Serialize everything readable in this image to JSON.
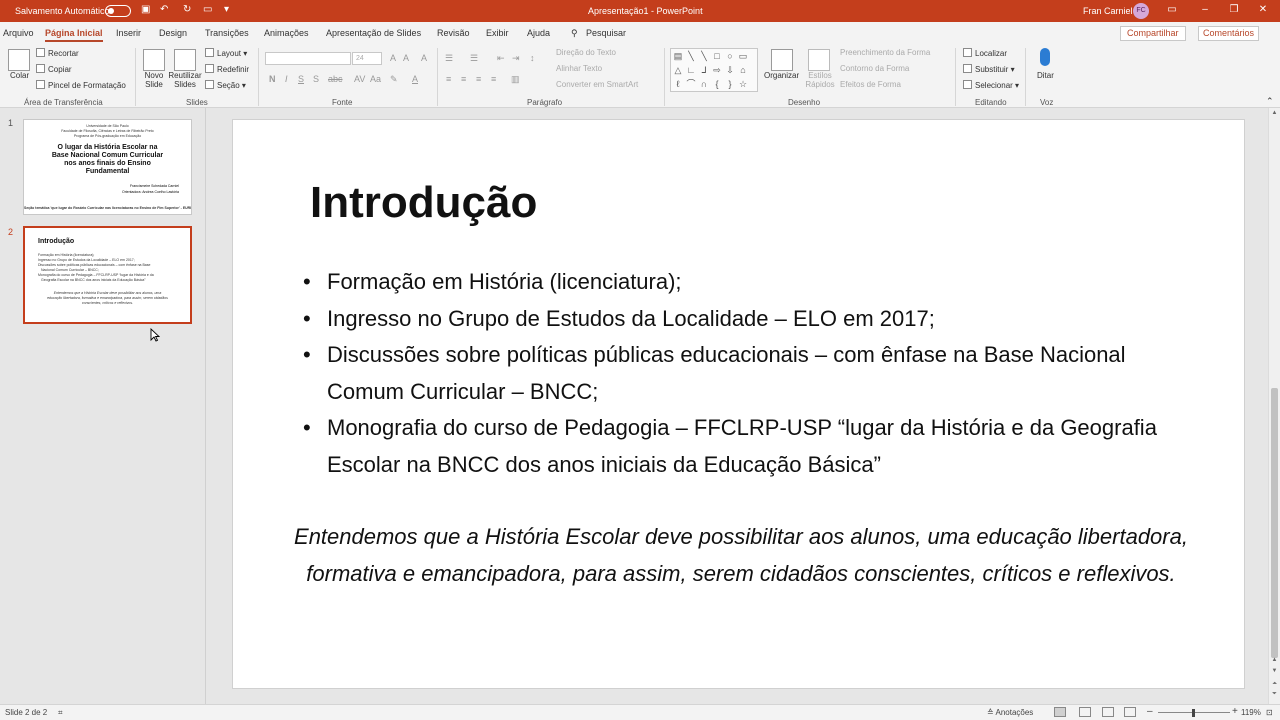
{
  "titlebar": {
    "autosave_label": "Salvamento Automático",
    "doc_title": "Apresentação1 - PowerPoint",
    "user_name": "Fran Carniel",
    "user_initials": "FC"
  },
  "tabs": {
    "items": [
      "Arquivo",
      "Página Inicial",
      "Inserir",
      "Design",
      "Transições",
      "Animações",
      "Apresentação de Slides",
      "Revisão",
      "Exibir",
      "Ajuda",
      "Pesquisar"
    ],
    "active": "Página Inicial",
    "share_label": "Compartilhar",
    "comments_label": "Comentários"
  },
  "ribbon": {
    "clipboard": {
      "paste": "Colar",
      "cut": "Recortar",
      "copy": "Copiar",
      "format_painter": "Pincel de Formatação",
      "group": "Área de Transferência"
    },
    "slides": {
      "new_slide": "Novo Slide",
      "reuse": "Reutilizar Slides",
      "layout": "Layout",
      "reset": "Redefinir",
      "section": "Seção",
      "group": "Slides"
    },
    "font": {
      "size": "24",
      "bold": "N",
      "italic": "I",
      "underline": "S",
      "strike": "S",
      "group": "Fonte"
    },
    "paragraph": {
      "text_direction": "Direção do Texto",
      "align_text": "Alinhar Texto",
      "smartart": "Converter em SmartArt",
      "group": "Parágrafo"
    },
    "drawing": {
      "arrange": "Organizar",
      "quick_styles": "Estilos Rápidos",
      "shape_fill": "Preenchimento da Forma",
      "shape_outline": "Contorno da Forma",
      "shape_effects": "Efeitos de Forma",
      "group": "Desenho"
    },
    "editing": {
      "find": "Localizar",
      "replace": "Substituir",
      "select": "Selecionar",
      "group": "Editando"
    },
    "voice": {
      "dictate": "Ditar",
      "group": "Voz"
    }
  },
  "thumbnails": {
    "slide1": {
      "number": "1",
      "lines_small": [
        "Universidade de São Paulo",
        "Faculdade de Filosofia, Ciências e Letras de Ribeirão Preto",
        "Programa de Pós-graduação em Educação"
      ],
      "title_lines": [
        "O lugar da História Escolar na",
        "Base Nacional Comum Curricular",
        "nos anos finais do Ensino",
        "Fundamental"
      ],
      "authors": [
        "Francismeire Schedada Carniel",
        "Orientadora: Andrea Coelho Lastória"
      ],
      "footer": "Seção temática 'que lugar do Rosário Curricular nas licenciaturas no Ensino de Fim Superior' - EURP"
    },
    "slide2": {
      "number": "2",
      "title": "Introdução",
      "bullets": [
        "Formação em História (licenciatura);",
        "Ingresso no Grupo de Estudos da Localidade – ELO em 2017;",
        "Discussões sobre políticas públicas educacionais – com ênfase na Base",
        "Nacional Comum Curricular – BNCC;",
        "Monografia do curso de Pedagogia – FFCLRP-USP “lugar da História e da",
        "Geografia Escolar na BNCC dos anos iniciais da Educação Básica”"
      ],
      "quote": [
        "Entendemos que a História Escolar deve possibilitar aos alunos, uma",
        "educação libertadora, formativa e emancipadora, para assim, serem cidadãos",
        "conscientes, críticos e reflexivos."
      ]
    }
  },
  "slide": {
    "title": "Introdução",
    "bullets": [
      "Formação em História (licenciatura);",
      "Ingresso no Grupo de Estudos da Localidade – ELO em 2017;",
      "Discussões sobre políticas públicas educacionais – com ênfase na Base Nacional Comum Curricular – BNCC;",
      "Monografia do curso de Pedagogia – FFCLRP-USP “lugar da História e da Geografia Escolar na BNCC dos anos iniciais da Educação Básica”"
    ],
    "quote": "Entendemos que a História Escolar deve possibilitar aos alunos, uma educação libertadora, formativa e emancipadora, para assim, serem cidadãos conscientes, críticos e reflexivos."
  },
  "status": {
    "slide_counter": "Slide 2 de 2",
    "notes": "Anotações",
    "zoom": "119%"
  },
  "colors": {
    "accent": "#c43e1c",
    "tab_active": "#b7472a"
  }
}
